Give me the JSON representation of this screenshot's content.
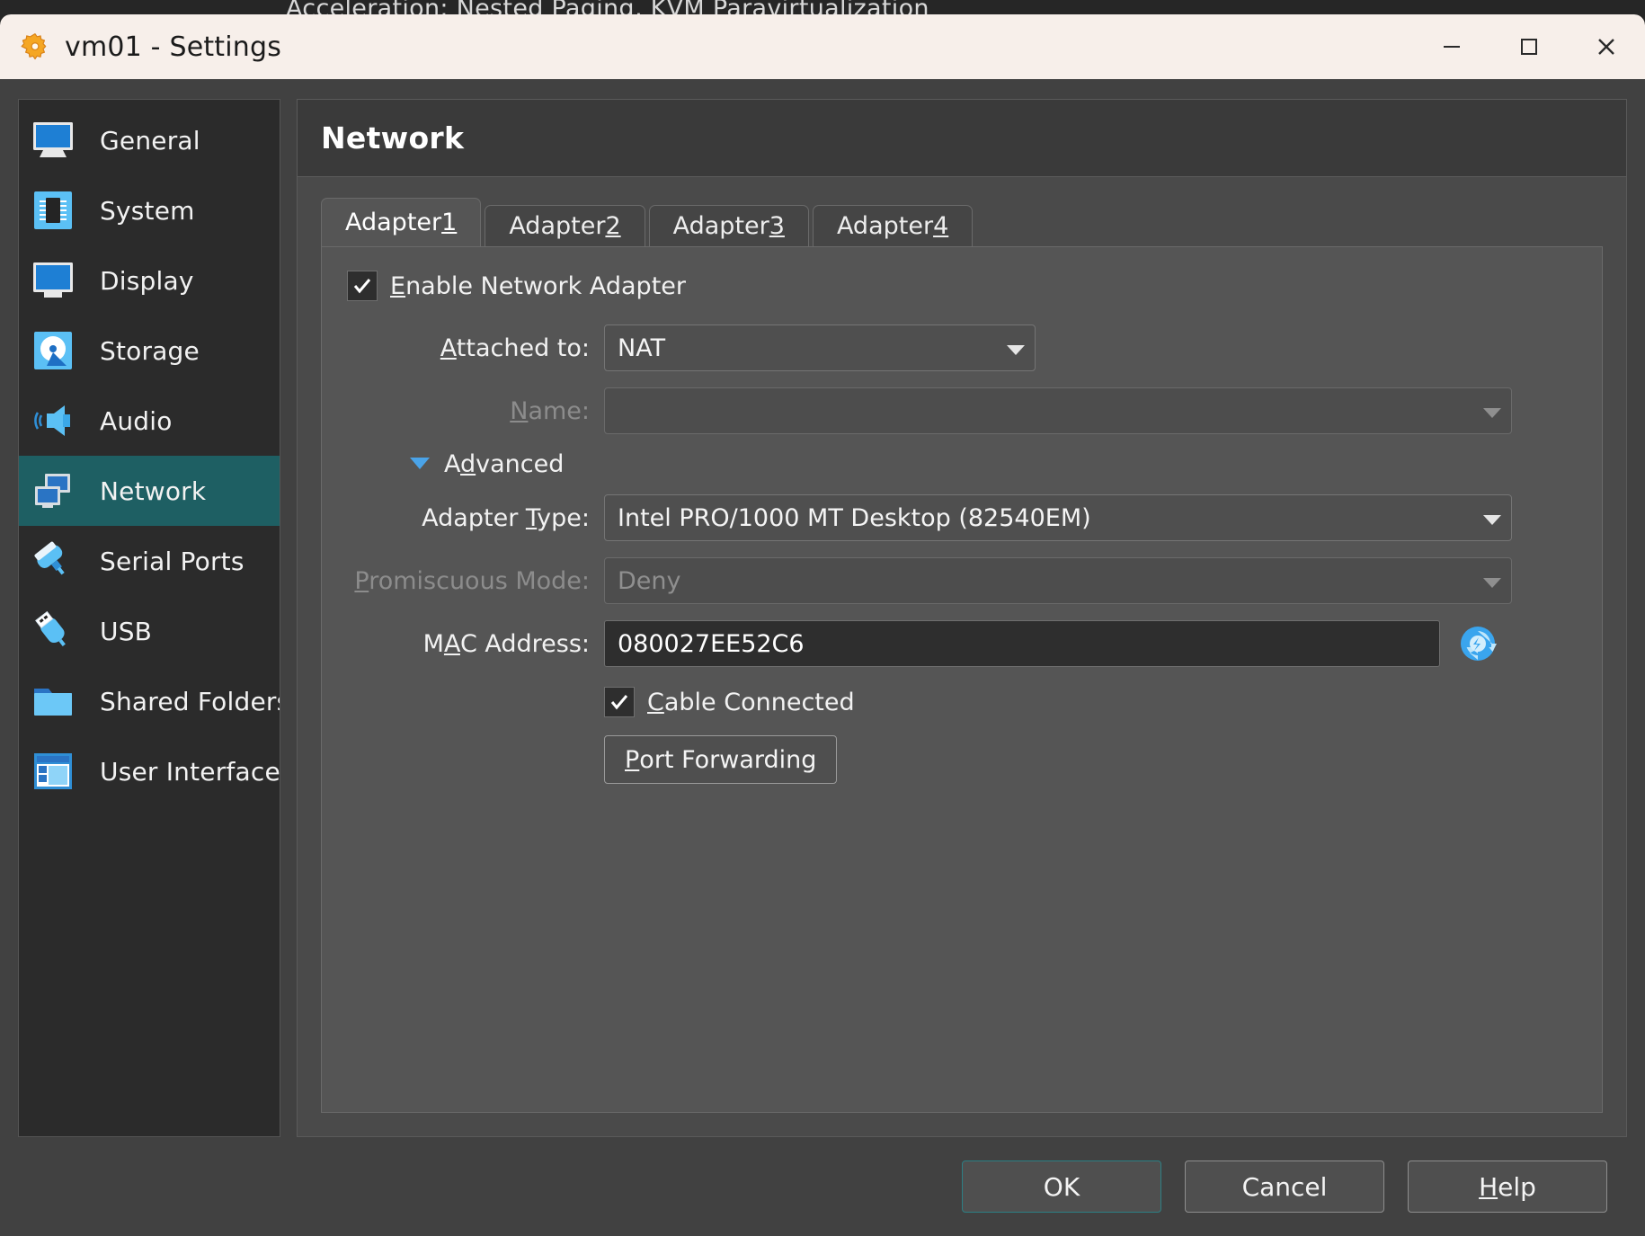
{
  "background": {
    "clipped_text": "Acceleration:     Nested Paging, KVM Paravirtualization"
  },
  "titlebar": {
    "icon": "gear-icon",
    "title": "vm01 - Settings",
    "minimize_label": "Minimize",
    "maximize_label": "Maximize",
    "close_label": "Close"
  },
  "sidebar": {
    "items": [
      {
        "label": "General",
        "icon": "monitor-icon",
        "selected": false
      },
      {
        "label": "System",
        "icon": "cpu-chip-icon",
        "selected": false
      },
      {
        "label": "Display",
        "icon": "display-monitor-icon",
        "selected": false
      },
      {
        "label": "Storage",
        "icon": "hard-disk-icon",
        "selected": false
      },
      {
        "label": "Audio",
        "icon": "speaker-icon",
        "selected": false
      },
      {
        "label": "Network",
        "icon": "network-icon",
        "selected": true
      },
      {
        "label": "Serial Ports",
        "icon": "serial-port-icon",
        "selected": false
      },
      {
        "label": "USB",
        "icon": "usb-icon",
        "selected": false
      },
      {
        "label": "Shared Folders",
        "icon": "folder-icon",
        "selected": false
      },
      {
        "label": "User Interface",
        "icon": "window-layout-icon",
        "selected": false
      }
    ]
  },
  "content": {
    "title": "Network",
    "tabs": [
      {
        "label": "Adapter ",
        "mnemonic": "1",
        "active": true
      },
      {
        "label": "Adapter ",
        "mnemonic": "2",
        "active": false
      },
      {
        "label": "Adapter ",
        "mnemonic": "3",
        "active": false
      },
      {
        "label": "Adapter ",
        "mnemonic": "4",
        "active": false
      }
    ],
    "enable_adapter": {
      "label_prefix": "",
      "mnemonic": "E",
      "label_rest": "nable Network Adapter",
      "checked": true
    },
    "attached_to": {
      "label_prefix": "",
      "mnemonic": "A",
      "label_rest": "ttached to:",
      "value": "NAT",
      "disabled": false
    },
    "name_field": {
      "label_prefix": "",
      "mnemonic": "N",
      "label_rest": "ame:",
      "value": "",
      "disabled": true
    },
    "advanced": {
      "label_prefix": "A",
      "mnemonic": "d",
      "label_rest": "vanced",
      "expanded": true,
      "icon": "triangle-down-icon"
    },
    "adapter_type": {
      "label_prefix": "Adapter ",
      "mnemonic": "T",
      "label_rest": "ype:",
      "value": "Intel PRO/1000 MT Desktop (82540EM)",
      "disabled": false
    },
    "promiscuous_mode": {
      "label_prefix": "",
      "mnemonic": "P",
      "label_rest": "romiscuous Mode:",
      "value": "Deny",
      "disabled": true
    },
    "mac_address": {
      "label_prefix": "M",
      "mnemonic": "A",
      "label_rest": "C Address:",
      "value": "080027EE52C6",
      "refresh_icon": "refresh-mac-icon"
    },
    "cable_connected": {
      "label_prefix": "",
      "mnemonic": "C",
      "label_rest": "able Connected",
      "checked": true
    },
    "port_forwarding": {
      "label_prefix": "",
      "mnemonic": "P",
      "label_rest": "ort Forwarding"
    }
  },
  "footer": {
    "ok": {
      "label_prefix": "OK",
      "mnemonic": "",
      "label_rest": ""
    },
    "cancel": {
      "label_prefix": "Cancel",
      "mnemonic": "",
      "label_rest": ""
    },
    "help": {
      "label_prefix": "",
      "mnemonic": "H",
      "label_rest": "elp"
    }
  },
  "colors": {
    "titlebar_bg": "#f7efea",
    "sidebar_bg": "#2b2b2b",
    "selection_teal": "#1e5f63",
    "panel_bg": "#555555",
    "accent_blue": "#4aa3e8"
  }
}
